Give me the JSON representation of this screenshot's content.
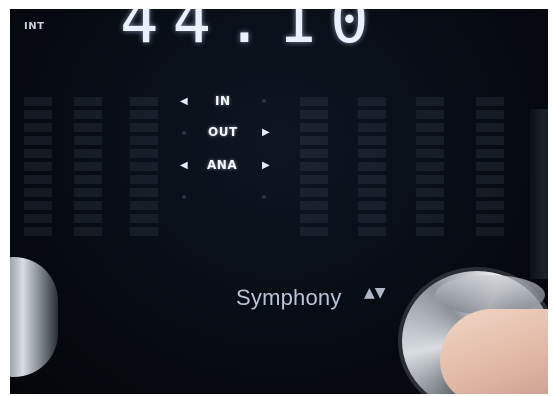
{
  "display": {
    "indicator": "INT",
    "readout": "44.10",
    "inputs": [
      {
        "label": "IN"
      },
      {
        "label": "OUT"
      },
      {
        "label": "ANA"
      }
    ]
  },
  "branding": {
    "model_name": "Symphony",
    "selector_glyph": "▲▼"
  },
  "icons": {
    "left_arrow": "◀",
    "right_arrow": "▶"
  },
  "colors": {
    "panel": "#070b12",
    "display_text": "#f4f7ff",
    "brand_text": "#b9c3d4"
  }
}
